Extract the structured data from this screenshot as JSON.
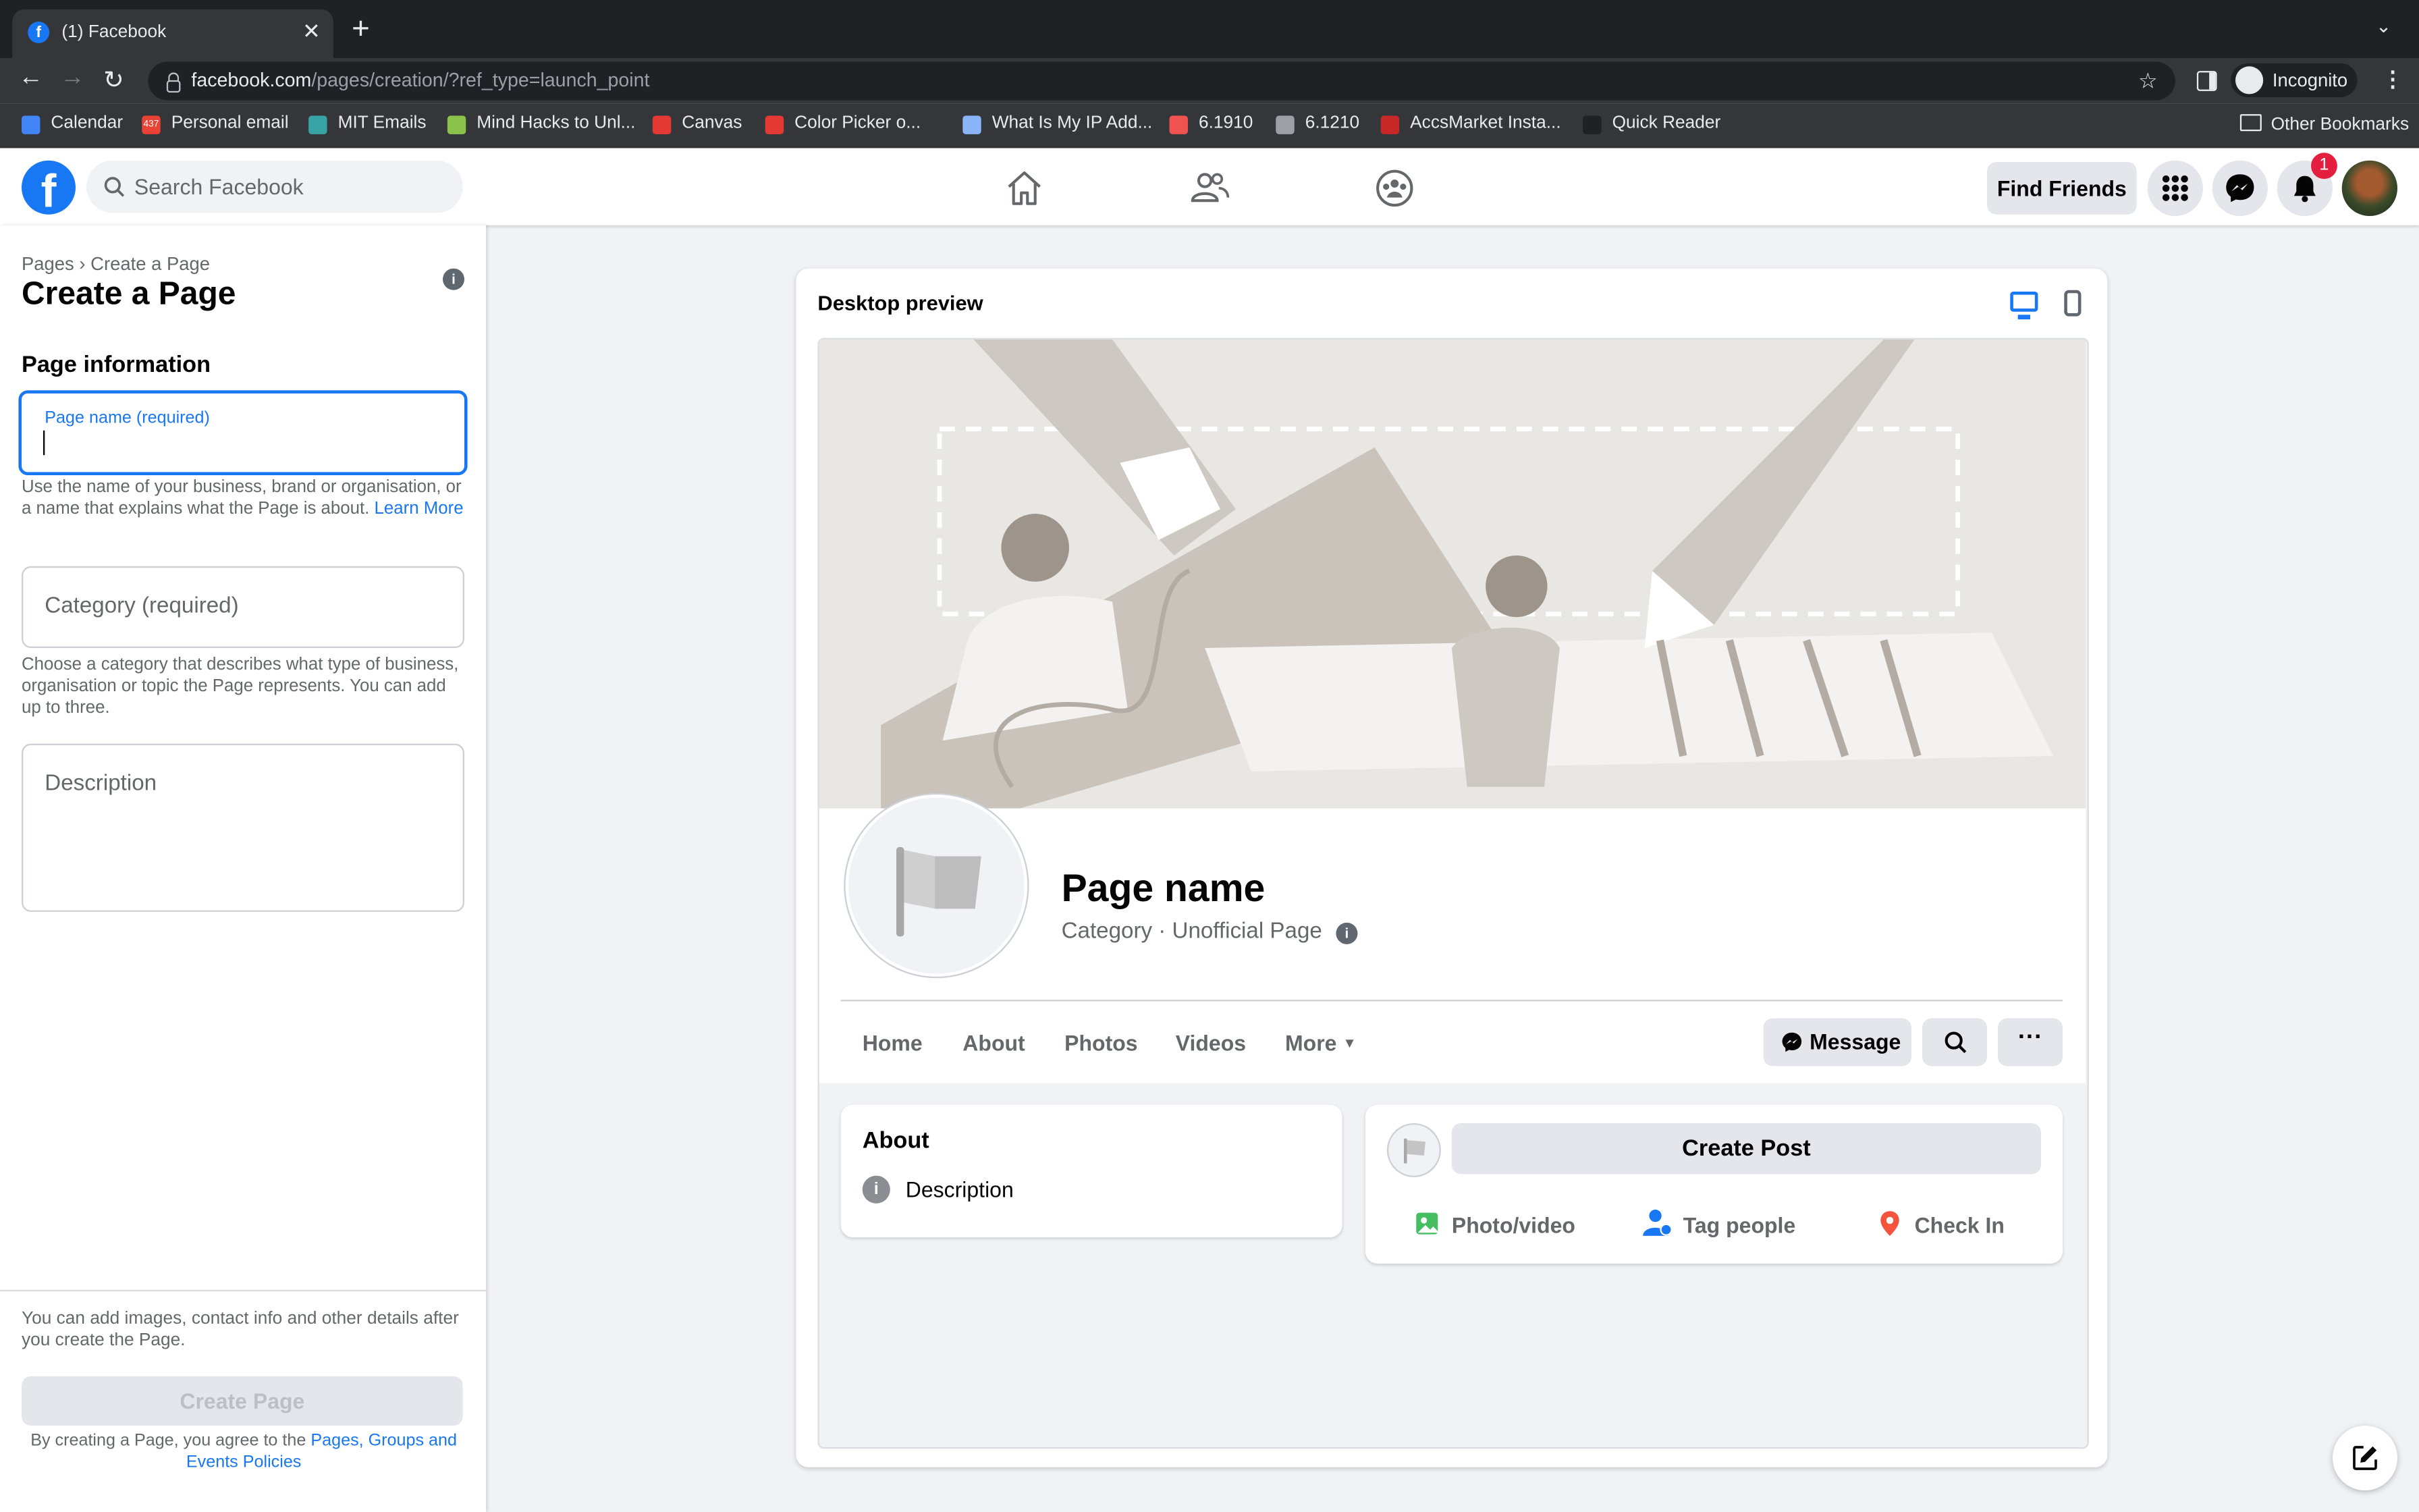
{
  "browser": {
    "tab_title": "(1) Facebook",
    "tab_favicon_letter": "f",
    "url_host": "facebook.com",
    "url_path": "/pages/creation/?ref_type=launch_point",
    "profile_label": "Incognito",
    "bookmarks": [
      {
        "label": "Calendar",
        "icon": "calendar-icon",
        "color": "#4285f4"
      },
      {
        "label": "Personal email",
        "icon": "mail-icon",
        "color": "#ea4335",
        "badge": "437"
      },
      {
        "label": "MIT Emails",
        "icon": "outlook-icon",
        "color": "#38a3a5"
      },
      {
        "label": "Mind Hacks to Unl...",
        "icon": "play-icon",
        "color": "#8bc34a"
      },
      {
        "label": "Canvas",
        "icon": "canvas-icon",
        "color": "#e53935"
      },
      {
        "label": "Color Picker o...",
        "icon": "color-picker-icon",
        "color": "#e53935"
      },
      {
        "label": "What Is My IP Add...",
        "icon": "ip-icon",
        "color": "#8ab4f8"
      },
      {
        "label": "6.1910",
        "icon": "course-icon",
        "color": "#ef5350"
      },
      {
        "label": "6.1210",
        "icon": "globe-icon",
        "color": "#9aa0a6"
      },
      {
        "label": "AccsMarket Insta...",
        "icon": "accsmarket-icon",
        "color": "#c62828"
      },
      {
        "label": "Quick Reader",
        "icon": "reader-icon",
        "color": "#202124"
      }
    ],
    "other_bookmarks": "Other Bookmarks"
  },
  "fb_header": {
    "logo": "f",
    "search_placeholder": "Search Facebook",
    "find_friends": "Find Friends",
    "notification_count": "1"
  },
  "left_panel": {
    "breadcrumb": "Pages › Create a Page",
    "title": "Create a Page",
    "section_title": "Page information",
    "page_name_label": "Page name (required)",
    "page_name_value": "",
    "page_name_hint": "Use the name of your business, brand or organisation, or a name that explains what the Page is about.",
    "learn_more": "Learn More",
    "category_placeholder": "Category (required)",
    "category_hint": "Choose a category that describes what type of business, organisation or topic the Page represents. You can add up to three.",
    "description_placeholder": "Description",
    "footer_note": "You can add images, contact info and other details after you create the Page.",
    "create_button": "Create Page",
    "terms_prefix": "By creating a Page, you agree to the",
    "terms_link": "Pages, Groups and Events Policies"
  },
  "preview": {
    "title": "Desktop preview",
    "page_name": "Page name",
    "category_line": "Category · Unofficial Page",
    "tabs": [
      "Home",
      "About",
      "Photos",
      "Videos",
      "More"
    ],
    "message_button": "Message",
    "about_title": "About",
    "about_description": "Description",
    "create_post": "Create Post",
    "actions": [
      {
        "label": "Photo/video",
        "icon": "photo-video-icon",
        "color": "#45bd62"
      },
      {
        "label": "Tag people",
        "icon": "tag-people-icon",
        "color": "#1877f2"
      },
      {
        "label": "Check In",
        "icon": "check-in-icon",
        "color": "#f5533d"
      }
    ]
  },
  "colors": {
    "accent": "#1877f2",
    "notification": "#e41e3f"
  }
}
